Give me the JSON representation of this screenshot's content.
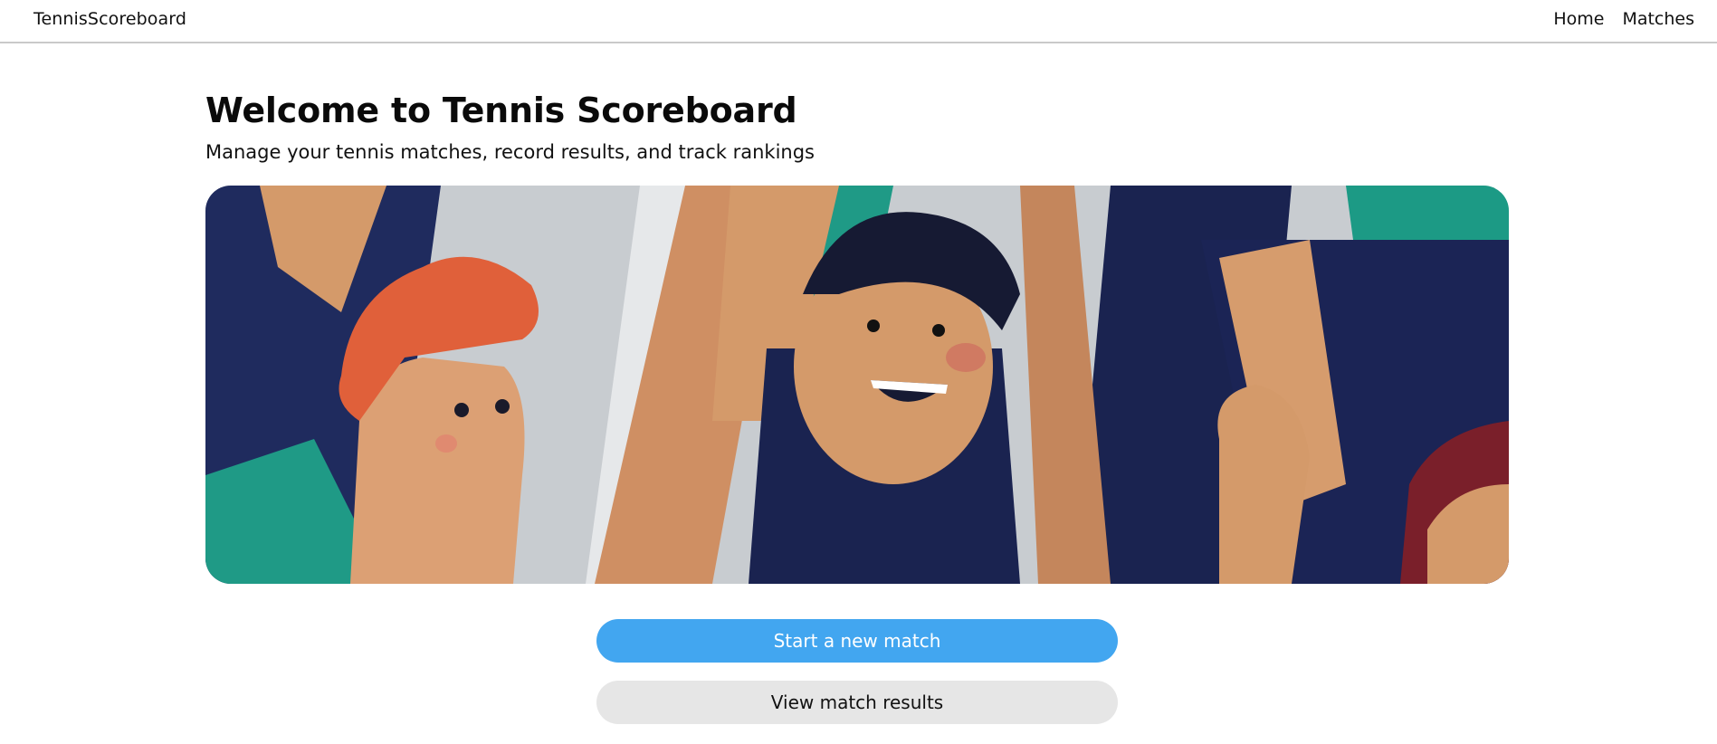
{
  "header": {
    "brand": "TennisScoreboard",
    "nav": [
      {
        "label": "Home"
      },
      {
        "label": "Matches"
      }
    ]
  },
  "main": {
    "title": "Welcome to Tennis Scoreboard",
    "subtitle": "Manage your tennis matches, record results, and track rankings",
    "hero_image": "cheering-fans-illustration",
    "buttons": {
      "start_match": "Start a new match",
      "view_results": "View match results"
    }
  },
  "colors": {
    "primary_button": "#42a6f0",
    "secondary_button": "#e6e6e6",
    "navy": "#1a2350",
    "teal": "#22a08a",
    "skin": "#d49a6a",
    "hair_red": "#e0603a"
  }
}
